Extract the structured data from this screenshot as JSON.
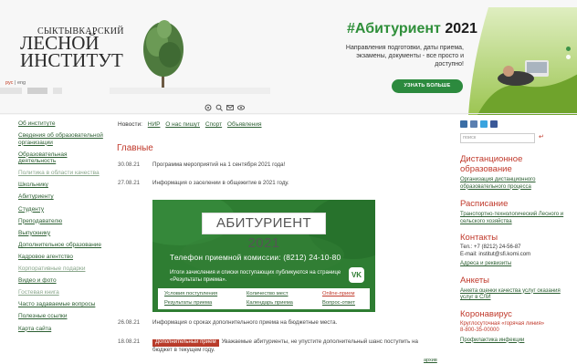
{
  "header": {
    "logo_small": "СЫКТЫВКАРСКИЙ",
    "logo_line1": "ЛЕСНОЙ",
    "logo_line2": "ИНСТИТУТ",
    "lang_ru": "рус",
    "lang_sep": "|",
    "lang_en": "eng",
    "promo_hash": "#Абитуриент",
    "promo_year": "2021",
    "promo_text": "Направления подготовки, даты приема, экзамены, документы - все просто и доступно!",
    "promo_button": "УЗНАТЬ БОЛЬШЕ",
    "icons": [
      "accessibility-icon",
      "search-icon",
      "mail-icon",
      "eye-icon"
    ]
  },
  "sidebar": {
    "items": [
      {
        "label": "Об институте",
        "muted": false
      },
      {
        "label": "Сведения об образовательной организации",
        "muted": false
      },
      {
        "label": "Образовательная деятельность",
        "muted": false
      },
      {
        "label": "Политика в области качества",
        "muted": true
      },
      {
        "label": "Школьнику",
        "muted": false
      },
      {
        "label": "Абитуриенту",
        "muted": false
      },
      {
        "label": "Студенту",
        "muted": false
      },
      {
        "label": "Преподавателю",
        "muted": false
      },
      {
        "label": "Выпускнику",
        "muted": false
      },
      {
        "label": "Дополнительное образование",
        "muted": false
      },
      {
        "label": "Кадровое агентство",
        "muted": false
      },
      {
        "label": "Корпоративные подарки",
        "muted": true
      },
      {
        "label": "Видео и фото",
        "muted": false
      },
      {
        "label": "Гостевая книга",
        "muted": true
      },
      {
        "label": "Часто задаваемые вопросы",
        "muted": false
      },
      {
        "label": "Полезные ссылки",
        "muted": false
      },
      {
        "label": "Карта сайта",
        "muted": false
      }
    ]
  },
  "news_nav": {
    "label": "Новости:",
    "links": [
      "НИР",
      "О нас пишут",
      "Спорт",
      "Объявления"
    ]
  },
  "main": {
    "title": "Главные",
    "news": [
      {
        "date": "30.08.21",
        "text": "Программа мероприятий на 1 сентября 2021 года!"
      },
      {
        "date": "27.08.21",
        "text": "Информация о заселении в общежитие в 2021 году."
      },
      {
        "date": "26.08.21",
        "text": "Информация о сроках дополнительного приема на бюджетные места."
      },
      {
        "date": "18.08.21",
        "badge": "Дополнительный прием",
        "text": "Уважаемые абитуриенты, не упустите дополнительный шанс поступить на бюджет в текущем году."
      }
    ],
    "archive": "архив"
  },
  "banner": {
    "title": "АБИТУРИЕНТ 2021",
    "phone": "Телефон приемной комиссии: (8212) 24-10-80",
    "note": "Итоги зачисления и списки поступающих публикуются на странице «Результаты приема».",
    "vk": "VK",
    "links": [
      {
        "label": "Условия поступления",
        "red": false
      },
      {
        "label": "Количество мест",
        "red": false
      },
      {
        "label": "Online-прием",
        "red": true
      },
      {
        "label": "Результаты приема",
        "red": false
      },
      {
        "label": "Календарь приема",
        "red": false
      },
      {
        "label": "Вопрос-ответ",
        "red": false
      }
    ]
  },
  "right": {
    "search_placeholder": "поиск",
    "search_submit": "↵",
    "distance_title": "Дистанционное образование",
    "distance_link": "Организация дистанционного образовательного процесса",
    "schedule_title": "Расписание",
    "schedule_link": "Транспортно-технологический Лесного и сельского хозяйства",
    "contacts_title": "Контакты",
    "phone": "Тел.: +7 (8212) 24-56-87",
    "email": "E-mail: institut@sfi.komi.com",
    "address_link": "Адреса и реквизиты",
    "surveys_title": "Анкеты",
    "surveys_link": "Анкета оценки качества услуг оказания услуг в СЛИ",
    "covid_title": "Коронавирус",
    "hotline": "Круглосуточная «горячая линия»",
    "hotline_phone": "8-800-35-00000",
    "prevention_link": "Профилактика инфекции",
    "social_icons": [
      "vk-icon",
      "blog-icon",
      "twitter-icon",
      "facebook-icon"
    ]
  },
  "colors": {
    "accent_green": "#2c8a3e",
    "link_green": "#2c5f32",
    "heading_red": "#c0392b",
    "banner_green": "#2e7d32"
  }
}
